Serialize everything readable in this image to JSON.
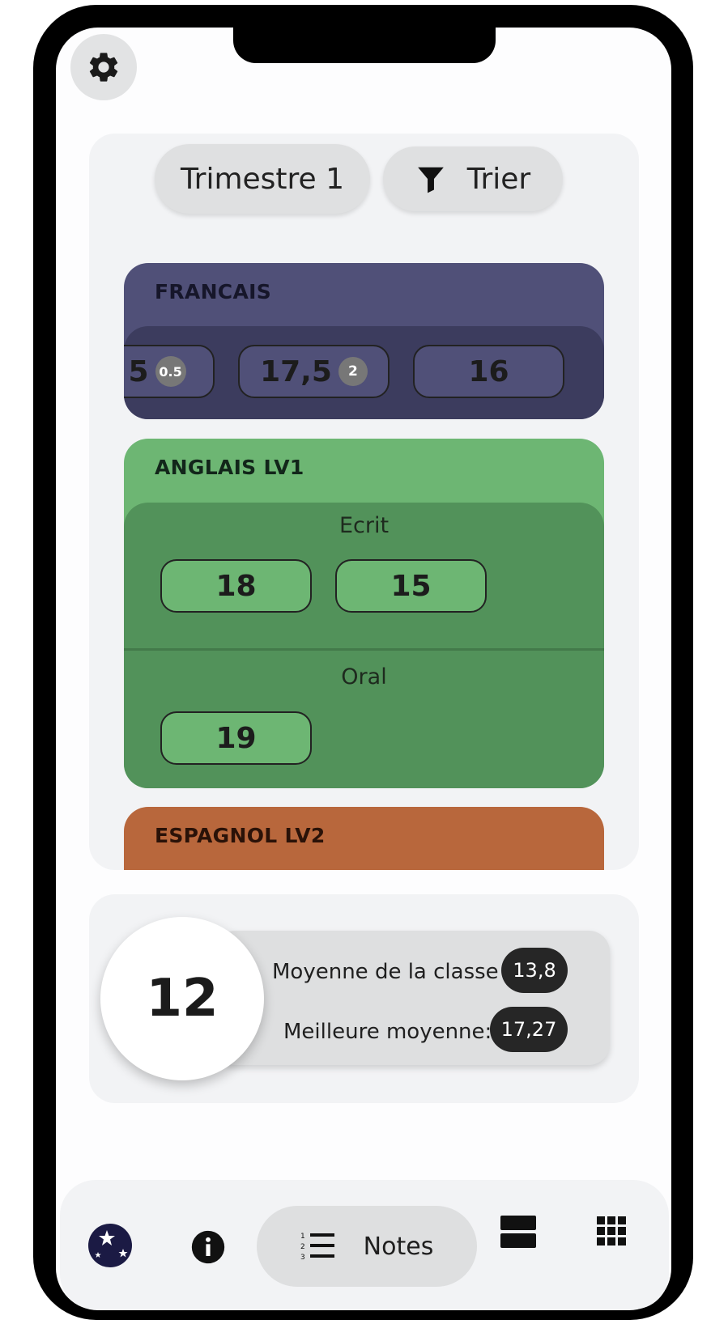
{
  "period_button": {
    "label": "Trimestre 1"
  },
  "sort_button": {
    "label": "Trier",
    "icon": "filter-icon"
  },
  "subjects": [
    {
      "title": "FRANCAIS",
      "color": "#505078",
      "inner_color": "#3c3c5e",
      "grades": [
        {
          "value": "5",
          "coef": "0.5"
        },
        {
          "value": "17,5",
          "coef": "2"
        },
        {
          "value": "16",
          "coef": ""
        }
      ]
    },
    {
      "title": "ANGLAIS LV1",
      "color": "#6db673",
      "inner_color": "#52925a",
      "sections": [
        {
          "label": "Ecrit",
          "grades": [
            "18",
            "15"
          ]
        },
        {
          "label": "Oral",
          "grades": [
            "19"
          ]
        }
      ]
    },
    {
      "title": "ESPAGNOL LV2",
      "color": "#b8673c"
    }
  ],
  "stats": {
    "student_average": "12",
    "class_average_label": "Moyenne de la classe :",
    "class_average": "13,8",
    "best_average_label": "Meilleure moyenne:",
    "best_average": "17,27"
  },
  "nav": {
    "items": [
      {
        "icon": "star-logo-icon"
      },
      {
        "icon": "info-icon"
      },
      {
        "icon": "numbered-list-icon",
        "label": "Notes",
        "active": true
      },
      {
        "icon": "rows-layout-icon"
      },
      {
        "icon": "grid-icon"
      }
    ]
  },
  "settings": {
    "icon": "gear-icon"
  }
}
